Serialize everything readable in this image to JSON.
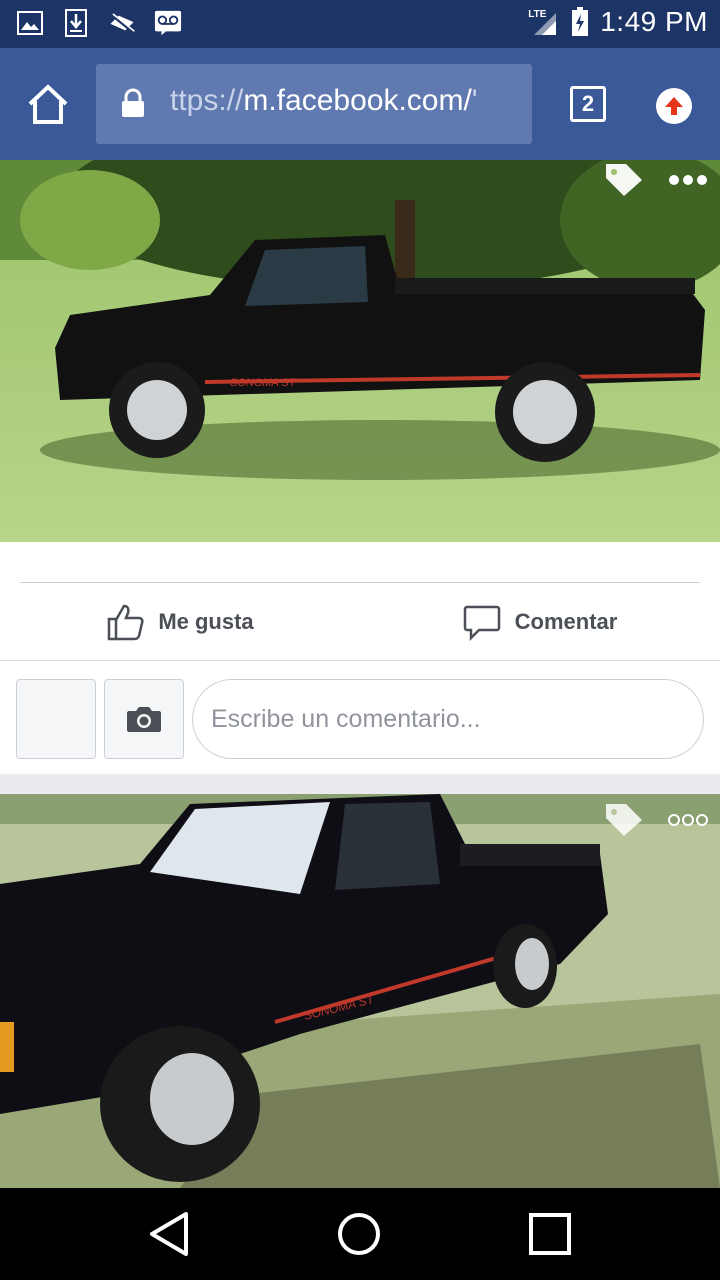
{
  "status_bar": {
    "time": "1:49 PM",
    "network": "LTE",
    "icons": [
      "image-icon",
      "download-icon",
      "no-sim-icon",
      "voicemail-icon",
      "signal-icon",
      "battery-charging-icon"
    ]
  },
  "browser": {
    "url_prefix": "ttps://",
    "url_domain": "m.facebook.com/",
    "url_suffix": "'",
    "tab_count": "2",
    "colors": {
      "toolbar": "#3b5998",
      "url_box": "#6079b0"
    }
  },
  "post": {
    "like_label": "Me gusta",
    "comment_label": "Comentar",
    "comment_placeholder": "Escribe un comentario..."
  },
  "photos": [
    {
      "subject": "black pickup truck side view",
      "decal": "SONOMA ST"
    },
    {
      "subject": "black pickup truck front three-quarter view",
      "decal": "SONOMA ST"
    }
  ]
}
